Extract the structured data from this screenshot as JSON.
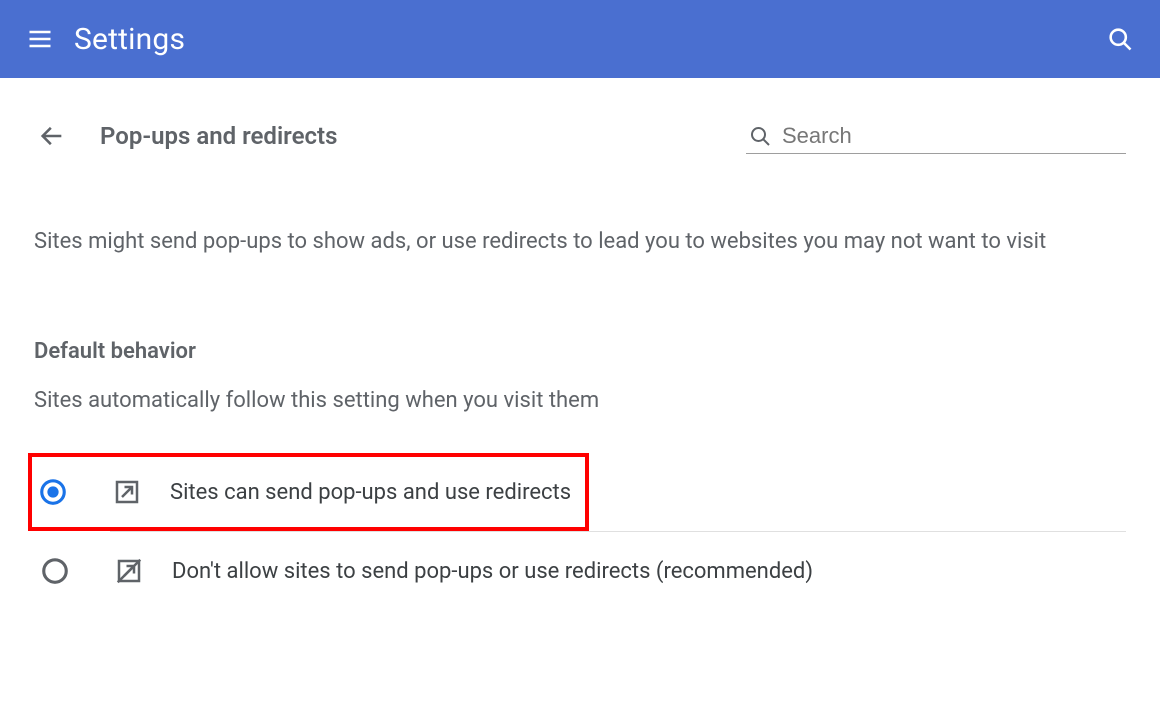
{
  "app_bar": {
    "title": "Settings"
  },
  "page": {
    "title": "Pop-ups and redirects",
    "search_placeholder": "Search",
    "description": "Sites might send pop-ups to show ads, or use redirects to lead you to websites you may not want to visit",
    "section_title": "Default behavior",
    "section_sub": "Sites automatically follow this setting when you visit them",
    "options": [
      {
        "label": "Sites can send pop-ups and use redirects",
        "selected": true,
        "highlighted": true
      },
      {
        "label": "Don't allow sites to send pop-ups or use redirects (recommended)",
        "selected": false,
        "highlighted": false
      }
    ]
  },
  "colors": {
    "accent": "#1a73e8",
    "appbar": "#4a6fd0",
    "highlight": "#ff0000"
  }
}
